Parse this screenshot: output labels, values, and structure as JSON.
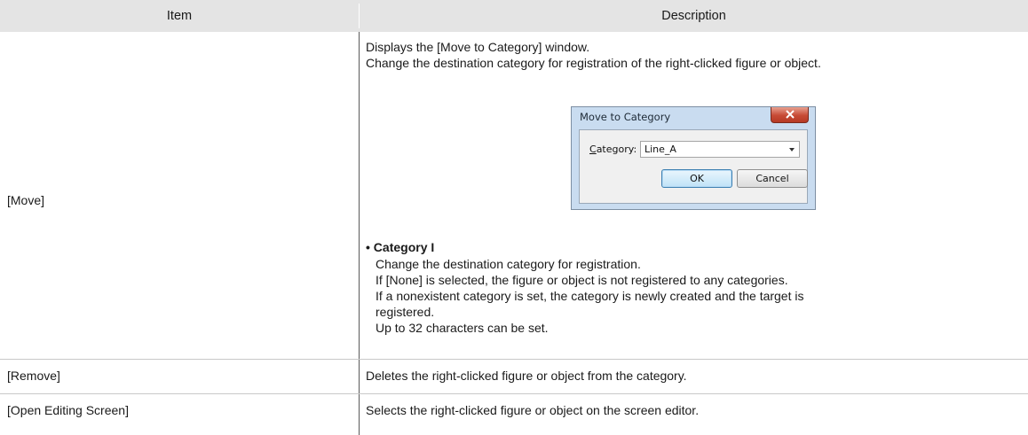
{
  "table": {
    "headers": {
      "item": "Item",
      "description": "Description"
    },
    "rows": [
      {
        "item": "[Move]",
        "description": [
          "Displays the [Move to Category] window.",
          "Change the destination category for registration of the right-clicked figure or object."
        ],
        "subheading": "• Category I",
        "sub_description": [
          "Change the destination category for registration.",
          "If [None] is selected, the figure or object is not registered to any categories.",
          "If a nonexistent category is set, the category is newly created and the target is",
          "registered.",
          "Up to 32 characters can be set."
        ]
      },
      {
        "item": "[Remove]",
        "description": "Deletes the right-clicked figure or object from the category."
      },
      {
        "item": "[Open Editing Screen]",
        "description": "Selects the right-clicked figure or object on the screen editor."
      }
    ]
  },
  "dialog": {
    "title": "Move to Category",
    "category_label_accel": "C",
    "category_label_rest": "ategory:",
    "category_value": "Line_A",
    "ok_label": "OK",
    "cancel_label": "Cancel",
    "close_icon": "close-icon"
  }
}
